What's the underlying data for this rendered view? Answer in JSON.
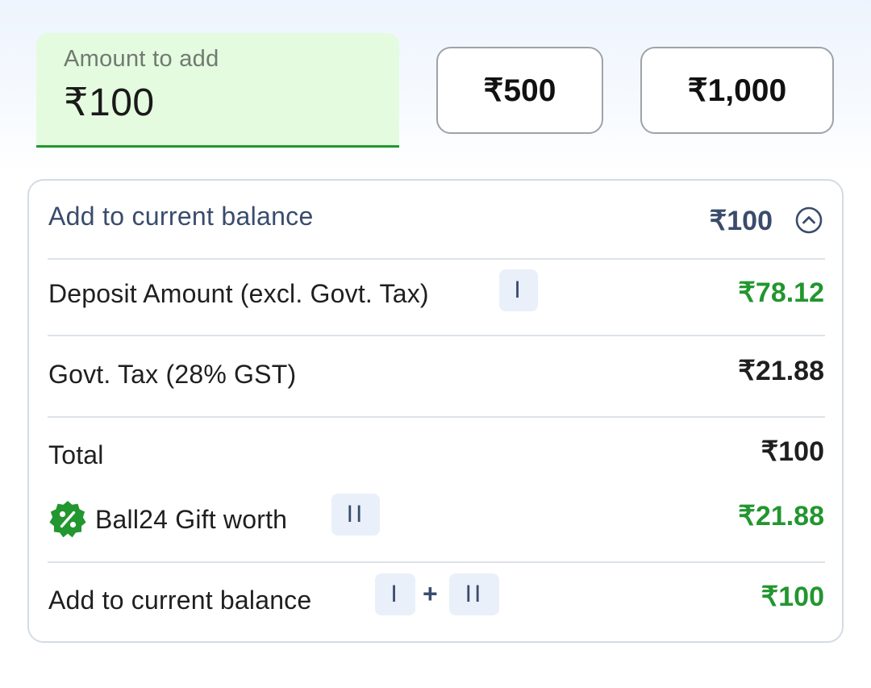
{
  "amount_field": {
    "label": "Amount to add",
    "value": "₹100"
  },
  "quick_amounts": [
    "₹500",
    "₹1,000"
  ],
  "breakdown": {
    "header_title": "Add to current balance",
    "header_amount": "₹100",
    "expanded": true,
    "deposit": {
      "label": "Deposit Amount (excl. Govt. Tax)",
      "tag": "I",
      "value": "₹78.12"
    },
    "tax": {
      "label": "Govt. Tax (28% GST)",
      "value": "₹21.88"
    },
    "total": {
      "label": "Total",
      "value": "₹100"
    },
    "gift": {
      "label": "Ball24 Gift worth",
      "tag": "II",
      "value": "₹21.88"
    },
    "add_balance": {
      "label": "Add to current balance",
      "tag1": "I",
      "plus": "+",
      "tag2": "II",
      "value": "₹100"
    }
  },
  "colors": {
    "accent_green": "#22962f",
    "field_bg": "#e4fbdf",
    "navy": "#3a4c6c",
    "tag_bg": "#e9f0fa"
  },
  "icons": {
    "chevron": "chevron-up-circle-icon",
    "gift": "discount-badge-icon"
  }
}
